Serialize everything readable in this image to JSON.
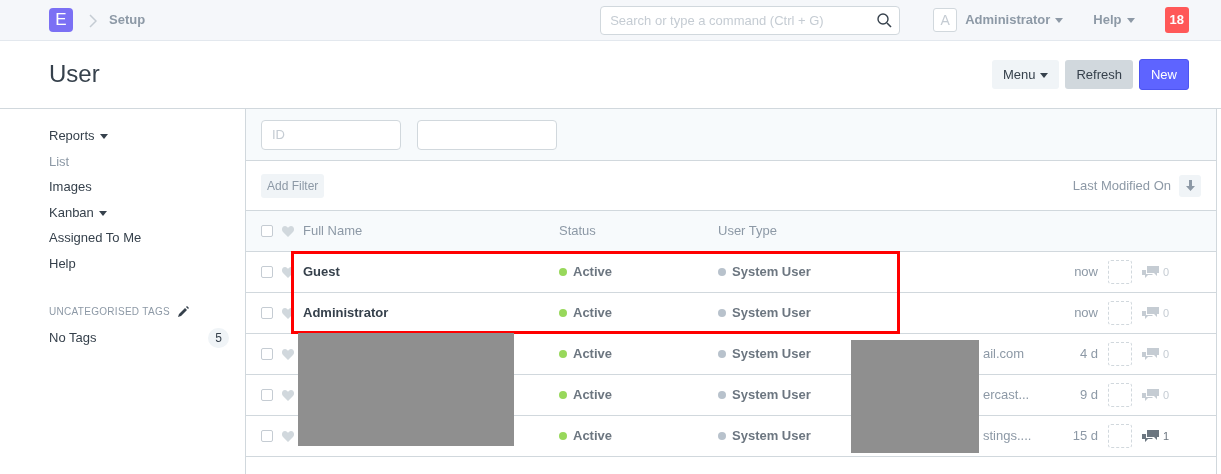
{
  "navbar": {
    "logo": "E",
    "breadcrumb": "Setup",
    "search": {
      "placeholder": "Search or type a command (Ctrl + G)"
    },
    "avatar": "A",
    "user": "Administrator",
    "help": "Help",
    "notifications": "18"
  },
  "page": {
    "title": "User",
    "buttons": [
      {
        "label": "Menu",
        "kind": "dropdown"
      },
      {
        "label": "Refresh",
        "kind": "secondary"
      },
      {
        "label": "New",
        "kind": "primary"
      }
    ]
  },
  "sidebar": {
    "items": [
      {
        "label": "Reports",
        "dropdown": true,
        "selected": false
      },
      {
        "label": "List",
        "dropdown": false,
        "selected": true
      },
      {
        "label": "Images",
        "dropdown": false,
        "selected": false
      },
      {
        "label": "Kanban",
        "dropdown": true,
        "selected": false
      },
      {
        "label": "Assigned To Me",
        "dropdown": false,
        "selected": false
      },
      {
        "label": "Help",
        "dropdown": false,
        "selected": false
      }
    ],
    "tags_heading": "UNCATEGORISED TAGS",
    "tags": [
      {
        "label": "No Tags",
        "count": "5"
      }
    ]
  },
  "filters": {
    "fields": [
      {
        "kind": "text",
        "placeholder": "ID"
      },
      {
        "kind": "text"
      }
    ],
    "add_filter": "Add Filter",
    "sort": "Last Modified On"
  },
  "table": {
    "all_checked": false,
    "columns": [
      "Full Name",
      "Status",
      "User Type"
    ],
    "rows": [
      {
        "name": "Guest",
        "status": "Active",
        "user_type": "System User",
        "time": "now",
        "comments": "0",
        "has_comments": false,
        "highlighted": true,
        "redacted": false,
        "checked": false
      },
      {
        "name": "Administrator",
        "status": "Active",
        "user_type": "System User",
        "time": "now",
        "comments": "0",
        "has_comments": false,
        "highlighted": true,
        "redacted": false,
        "checked": false
      },
      {
        "email": "ail.com",
        "status": "Active",
        "user_type": "System User",
        "time": "4 d",
        "comments": "0",
        "has_comments": false,
        "highlighted": false,
        "redacted": true,
        "checked": false
      },
      {
        "email": "ercast...",
        "status": "Active",
        "user_type": "System User",
        "time": "9 d",
        "comments": "0",
        "has_comments": false,
        "highlighted": false,
        "redacted": true,
        "checked": false
      },
      {
        "email": "stings....",
        "status": "Active",
        "user_type": "System User",
        "time": "15 d",
        "comments": "1",
        "has_comments": true,
        "highlighted": false,
        "redacted": true,
        "checked": false
      }
    ]
  }
}
